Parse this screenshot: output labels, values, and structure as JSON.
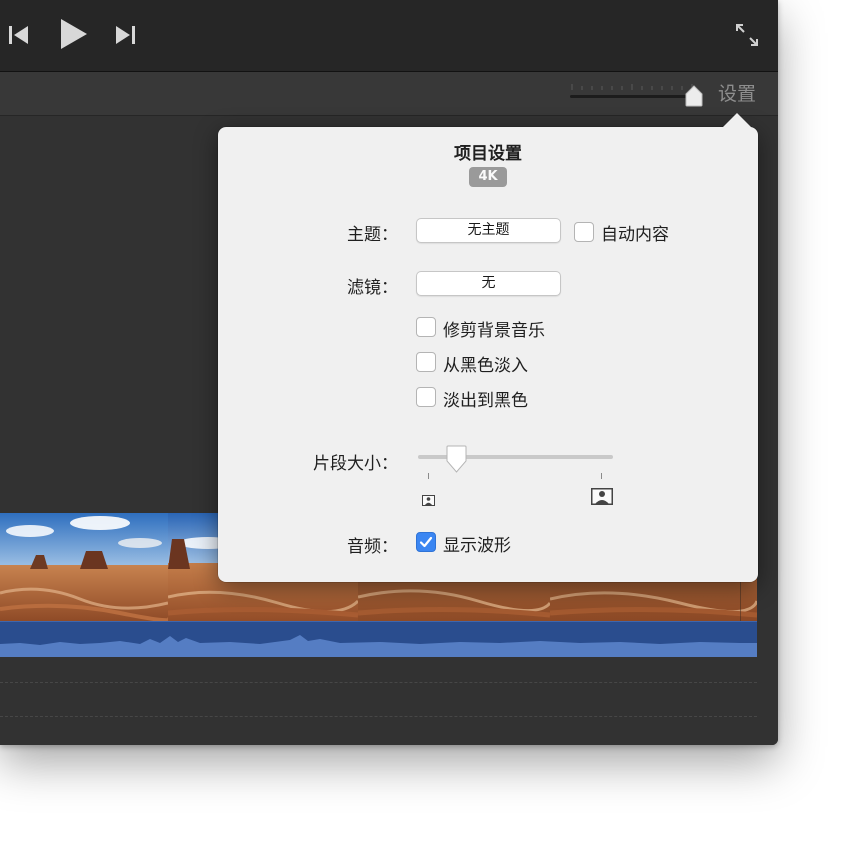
{
  "toolbar": {
    "prev_icon": "skip-back-icon",
    "play_icon": "play-icon",
    "next_icon": "skip-forward-icon",
    "fullscreen_icon": "fullscreen-icon"
  },
  "subbar": {
    "settings_label": "设置"
  },
  "popover": {
    "title": "项目设置",
    "badge": "4K",
    "theme": {
      "label": "主题：",
      "value": "无主题",
      "auto_content_label": "自动内容",
      "auto_content_checked": false
    },
    "filter": {
      "label": "滤镜：",
      "value": "无"
    },
    "options": [
      {
        "label": "修剪背景音乐",
        "checked": false
      },
      {
        "label": "从黑色淡入",
        "checked": false
      },
      {
        "label": "淡出到黑色",
        "checked": false
      }
    ],
    "clip_size": {
      "label": "片段大小：",
      "value_fraction": 0.2,
      "small_icon": "small-person-icon",
      "large_icon": "large-person-icon"
    },
    "audio": {
      "label": "音频：",
      "show_waveform_label": "显示波形",
      "show_waveform_checked": true
    }
  },
  "colors": {
    "accent": "#3b86f2",
    "audio_track": "#2a4d8e",
    "window": "#2f2f2f",
    "popover": "#f0f0f0"
  }
}
